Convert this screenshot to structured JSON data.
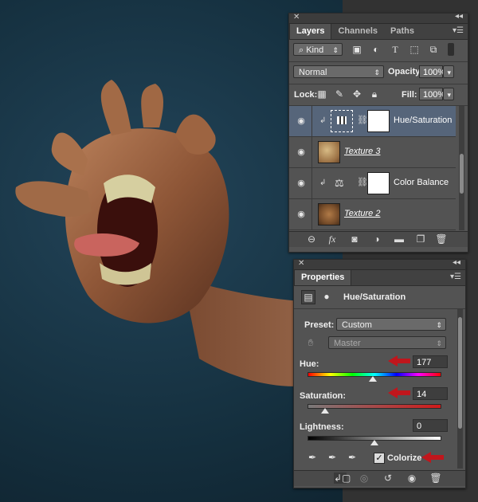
{
  "layers_panel": {
    "tabs": [
      "Layers",
      "Channels",
      "Paths"
    ],
    "filter_kind": "Kind",
    "blend_mode": "Normal",
    "opacity_label": "Opacity:",
    "opacity_value": "100%",
    "lock_label": "Lock:",
    "fill_label": "Fill:",
    "fill_value": "100%",
    "layers": [
      {
        "name": "Hue/Saturation",
        "type": "adjustment",
        "selected": true
      },
      {
        "name": "Texture 3",
        "type": "texture",
        "selected": false
      },
      {
        "name": "Color Balance",
        "type": "adjustment",
        "selected": false
      },
      {
        "name": "Texture 2",
        "type": "texture",
        "selected": false
      }
    ],
    "footer_icons": [
      "link-icon",
      "fx-icon",
      "mask-icon",
      "adjustment-icon",
      "folder-icon",
      "new-layer-icon",
      "trash-icon"
    ]
  },
  "properties_panel": {
    "tab": "Properties",
    "adjustment_name": "Hue/Saturation",
    "preset_label": "Preset:",
    "preset_value": "Custom",
    "channel_value": "Master",
    "hue_label": "Hue:",
    "hue_value": "177",
    "saturation_label": "Saturation:",
    "saturation_value": "14",
    "lightness_label": "Lightness:",
    "lightness_value": "0",
    "colorize_label": "Colorize",
    "colorize_checked": true,
    "hue_slider_position": 0.49,
    "saturation_slider_position": 0.14,
    "lightness_slider_position": 0.5
  },
  "colors": {
    "panel_bg": "#535353",
    "selected_layer": "#56657a",
    "annotation_arrow": "#c0161c",
    "canvas_bg": "#1b3b4d"
  }
}
